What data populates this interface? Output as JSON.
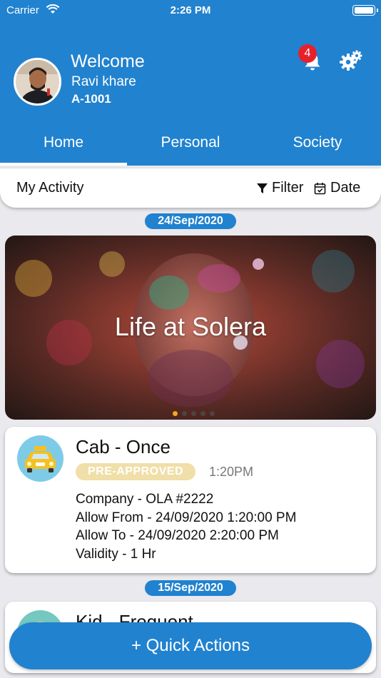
{
  "status_bar": {
    "carrier": "Carrier",
    "time": "2:26 PM"
  },
  "header": {
    "welcome": "Welcome",
    "user_name": "Ravi khare",
    "flat_id": "A-1001",
    "notification_count": "4",
    "brand_color": "#2182cf"
  },
  "tabs": [
    {
      "label": "Home",
      "active": true
    },
    {
      "label": "Personal",
      "active": false
    },
    {
      "label": "Society",
      "active": false
    }
  ],
  "activity": {
    "title": "My Activity",
    "filter_label": "Filter",
    "date_label": "Date"
  },
  "feed": {
    "date_1": "24/Sep/2020",
    "banner": {
      "text": "Life at Solera",
      "slides": 5,
      "active_slide": 1
    },
    "card_1": {
      "title": "Cab - Once",
      "badge": "PRE-APPROVED",
      "time": "1:20PM",
      "lines": [
        "Company - OLA #2222",
        "Allow From - 24/09/2020 1:20:00 PM",
        "Allow To - 24/09/2020 2:20:00 PM",
        "Validity - 1 Hr"
      ]
    },
    "date_2": "15/Sep/2020",
    "card_2": {
      "title": "Kid - Frequent"
    }
  },
  "quick_actions": {
    "label": "+ Quick Actions"
  }
}
